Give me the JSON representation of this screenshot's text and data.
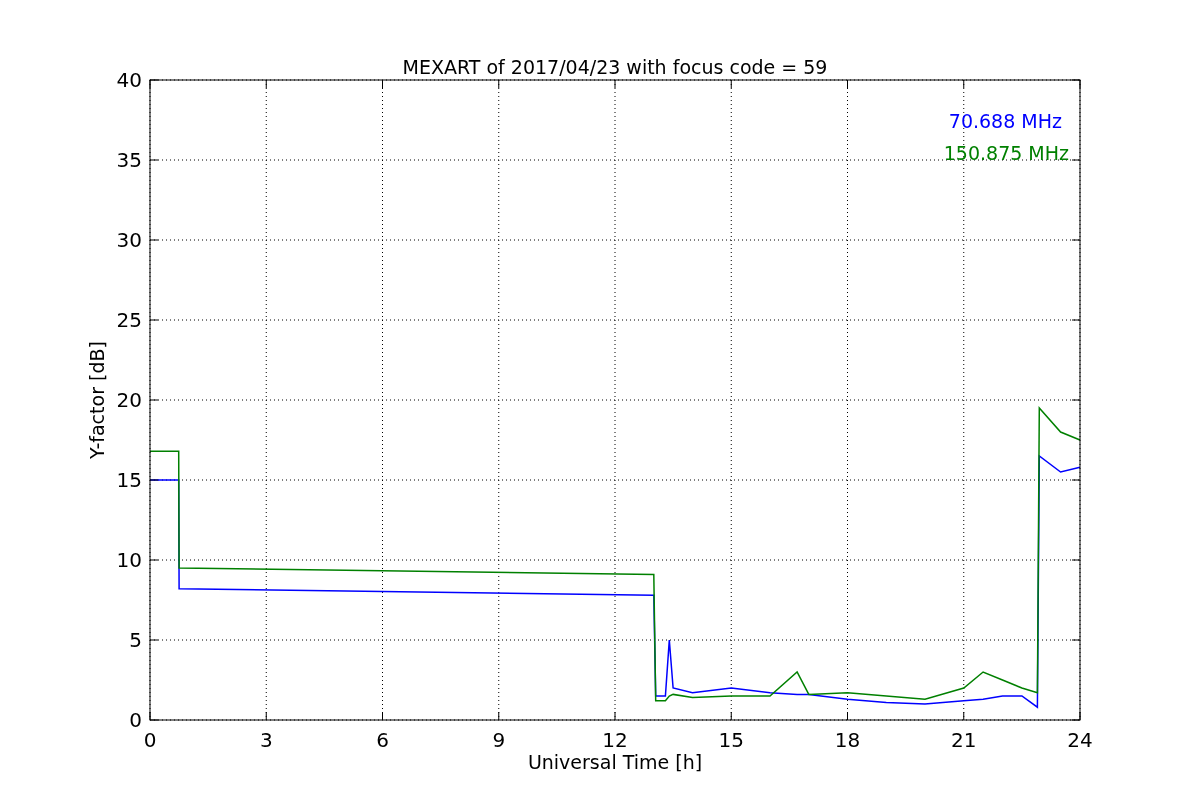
{
  "figure": {
    "chart_data": {
      "type": "line",
      "title": "MEXART of 2017/04/23 with focus code = 59",
      "xlabel": "Universal Time [h]",
      "ylabel": "Y-factor [dB]",
      "x": [
        0,
        0.74,
        0.75,
        13.0,
        13.05,
        13.3,
        13.4,
        13.5,
        14,
        15,
        16,
        16.7,
        17,
        18,
        19,
        20,
        21,
        21.5,
        22,
        22.5,
        22.9,
        22.95,
        23.5,
        24
      ],
      "series": [
        {
          "name": "70.688 MHz",
          "color": "#0000ff",
          "values": [
            15,
            15,
            8.2,
            7.8,
            1.5,
            1.5,
            5,
            2,
            1.7,
            2,
            1.7,
            1.6,
            1.6,
            1.3,
            1.1,
            1,
            1.2,
            1.3,
            1.5,
            1.5,
            0.8,
            16.5,
            15.5,
            15.8
          ]
        },
        {
          "name": "150.875 MHz",
          "color": "#008000",
          "values": [
            16.8,
            16.8,
            9.5,
            9.1,
            1.2,
            1.2,
            1.5,
            1.6,
            1.4,
            1.5,
            1.5,
            3,
            1.6,
            1.7,
            1.5,
            1.3,
            2,
            3,
            2.5,
            2,
            1.7,
            19.5,
            18,
            17.5
          ]
        }
      ],
      "xlim": [
        0,
        24
      ],
      "ylim": [
        0,
        40
      ],
      "xticks": [
        0,
        3,
        6,
        9,
        12,
        15,
        18,
        21,
        24
      ],
      "yticks": [
        0,
        5,
        10,
        15,
        20,
        25,
        30,
        35,
        40
      ],
      "grid": true
    }
  }
}
